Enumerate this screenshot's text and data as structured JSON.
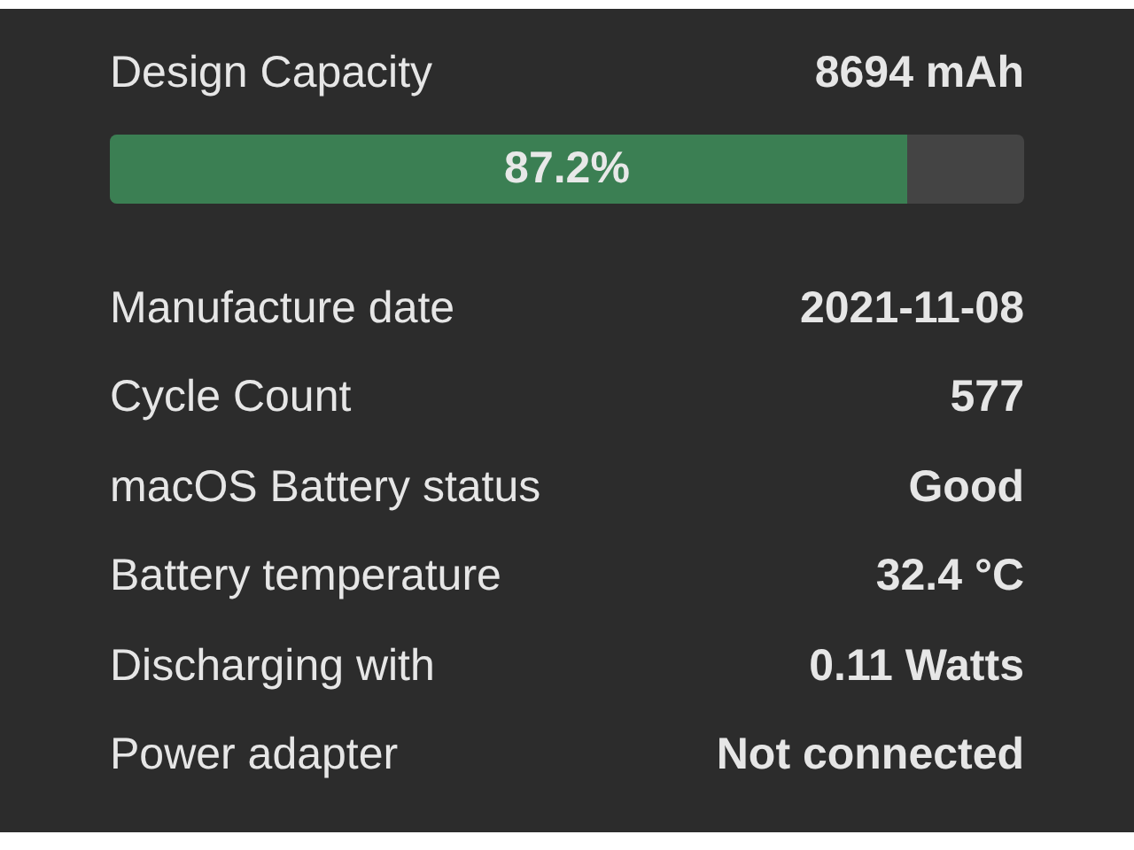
{
  "capacity": {
    "label": "Design Capacity",
    "value": "8694 mAh"
  },
  "health_bar": {
    "level": 0.872,
    "reading": "87.2%"
  },
  "details": [
    {
      "label": "Manufacture date",
      "value": "2021-11-08"
    },
    {
      "label": "Cycle Count",
      "value": "577"
    },
    {
      "label": "macOS Battery status",
      "value": "Good"
    },
    {
      "label": "Battery temperature",
      "value": "32.4 °C"
    },
    {
      "label": "Discharging with",
      "value": "0.11 Watts"
    },
    {
      "label": "Power adapter",
      "value": "Not connected"
    }
  ]
}
